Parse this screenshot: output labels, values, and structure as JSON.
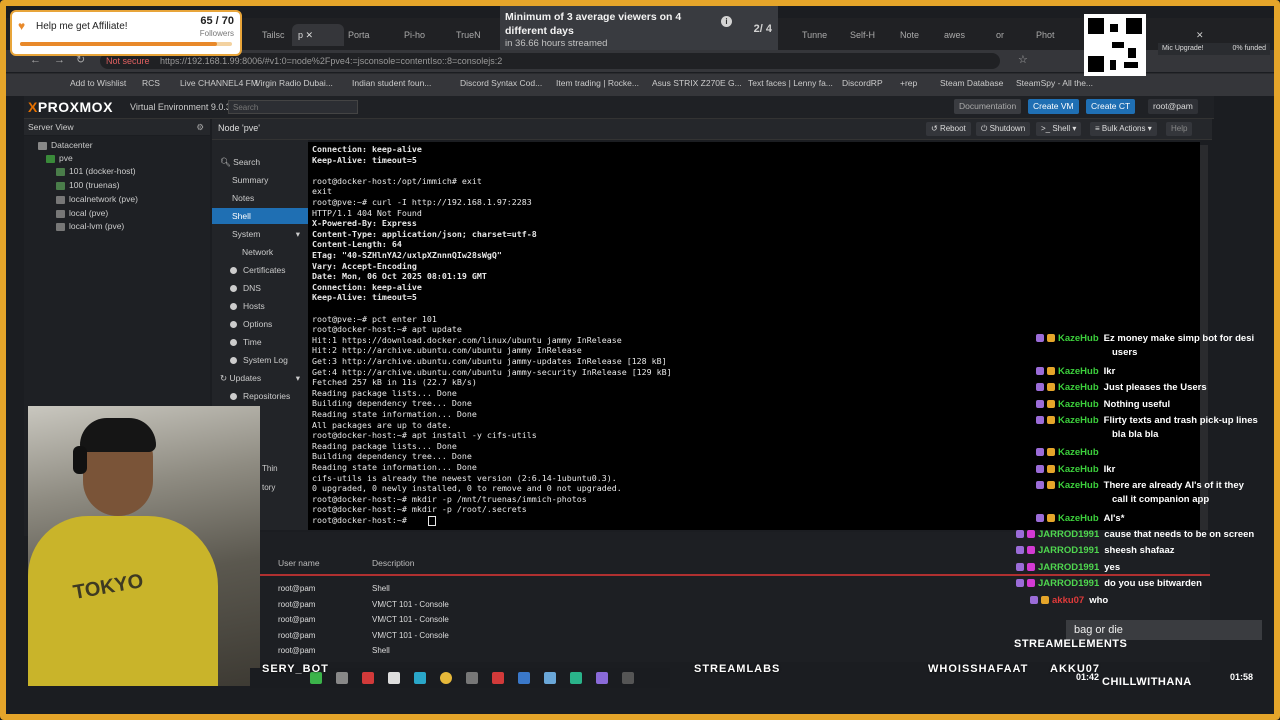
{
  "affiliate": {
    "text": "Help me get Affiliate!",
    "count": "65 / 70",
    "label": "Followers",
    "progress": 0.93
  },
  "goal": {
    "title": "Minimum of 3 average viewers on 4 different days",
    "sub": "in 36.66 hours streamed",
    "counter": "2/ 4",
    "info_icon": "i"
  },
  "mic_upgrade": {
    "label": "Mic Upgrade!",
    "funded": "0% funded",
    "progress": 0.0
  },
  "browser": {
    "tabs": [
      "Tailsc",
      "p",
      "Porta",
      "Pi-ho",
      "TrueN",
      "Tunne",
      "Self-H",
      "Note",
      "awes",
      "or",
      "Phot"
    ],
    "address_not_secure": "Not secure",
    "address": "https://192.168.1.99:8006/#v1:0=node%2Fpve4:=jsconsole=contentIso::8=consolejs:2",
    "bookmarks": [
      "Add to Wishlist",
      "RCS",
      "Live CHANNEL4 FM",
      "Virgin Radio Dubai...",
      "Indian student foun...",
      "Discord Syntax Cod...",
      "Item trading | Rocke...",
      "Asus STRIX Z270E G...",
      "Text faces | Lenny fa...",
      "DiscordRP",
      "+rep",
      "Steam Database",
      "SteamSpy - All the..."
    ]
  },
  "proxmox": {
    "logo_x": "X",
    "logo_rest": "PROXMOX",
    "version": "Virtual Environment 9.0.3",
    "search_placeholder": "Search",
    "header_buttons": {
      "docs": "Documentation",
      "create_vm": "Create VM",
      "create_ct": "Create CT",
      "user": "root@pam"
    },
    "server_view": "Server View",
    "tree": {
      "datacenter": "Datacenter",
      "node": "pve",
      "items": [
        "101 (docker-host)",
        "100 (truenas)",
        "localnetwork (pve)",
        "local (pve)",
        "local-lvm (pve)"
      ]
    },
    "node_title": "Node 'pve'",
    "node_buttons": {
      "reboot": "Reboot",
      "shutdown": "Shutdown",
      "shell": "Shell",
      "bulk": "Bulk Actions",
      "help": "Help"
    },
    "nav": [
      "Search",
      "Summary",
      "Notes",
      "Shell",
      "System",
      "Network",
      "Certificates",
      "DNS",
      "Hosts",
      "Options",
      "Time",
      "System Log",
      "Updates",
      "Repositories",
      "Thin",
      "tory"
    ],
    "task_columns": {
      "user": "User name",
      "desc": "Description"
    },
    "tasks": [
      {
        "user": "root@pam",
        "desc": "Shell"
      },
      {
        "user": "root@pam",
        "desc": "VM/CT 101 - Console"
      },
      {
        "user": "root@pam",
        "desc": "VM/CT 101 - Console"
      },
      {
        "user": "root@pam",
        "desc": "VM/CT 101 - Console"
      },
      {
        "user": "root@pam",
        "desc": "Shell"
      }
    ]
  },
  "terminal": [
    {
      "t": "Connection: keep-alive",
      "b": true
    },
    {
      "t": "Keep-Alive: timeout=5",
      "b": true
    },
    {
      "t": "",
      "b": false
    },
    {
      "t": "root@docker-host:/opt/immich# exit",
      "b": false
    },
    {
      "t": "exit",
      "b": false
    },
    {
      "t": "root@pve:~# curl -I http://192.168.1.97:2283",
      "b": false
    },
    {
      "t": "HTTP/1.1 404 Not Found",
      "b": false
    },
    {
      "t": "X-Powered-By: Express",
      "b": true
    },
    {
      "t": "Content-Type: application/json; charset=utf-8",
      "b": true
    },
    {
      "t": "Content-Length: 64",
      "b": true
    },
    {
      "t": "ETag: \"40-SZHlnYA2/uxlpXZnnnQIw28sWgQ\"",
      "b": true
    },
    {
      "t": "Vary: Accept-Encoding",
      "b": true
    },
    {
      "t": "Date: Mon, 06 Oct 2025 08:01:19 GMT",
      "b": true
    },
    {
      "t": "Connection: keep-alive",
      "b": true
    },
    {
      "t": "Keep-Alive: timeout=5",
      "b": true
    },
    {
      "t": "",
      "b": false
    },
    {
      "t": "root@pve:~# pct enter 101",
      "b": false
    },
    {
      "t": "root@docker-host:~# apt update",
      "b": false
    },
    {
      "t": "Hit:1 https://download.docker.com/linux/ubuntu jammy InRelease",
      "b": false
    },
    {
      "t": "Hit:2 http://archive.ubuntu.com/ubuntu jammy InRelease",
      "b": false
    },
    {
      "t": "Get:3 http://archive.ubuntu.com/ubuntu jammy-updates InRelease [128 kB]",
      "b": false
    },
    {
      "t": "Get:4 http://archive.ubuntu.com/ubuntu jammy-security InRelease [129 kB]",
      "b": false
    },
    {
      "t": "Fetched 257 kB in 11s (22.7 kB/s)",
      "b": false
    },
    {
      "t": "Reading package lists... Done",
      "b": false
    },
    {
      "t": "Building dependency tree... Done",
      "b": false
    },
    {
      "t": "Reading state information... Done",
      "b": false
    },
    {
      "t": "All packages are up to date.",
      "b": false
    },
    {
      "t": "root@docker-host:~# apt install -y cifs-utils",
      "b": false
    },
    {
      "t": "Reading package lists... Done",
      "b": false
    },
    {
      "t": "Building dependency tree... Done",
      "b": false
    },
    {
      "t": "Reading state information... Done",
      "b": false
    },
    {
      "t": "cifs-utils is already the newest version (2:6.14-1ubuntu0.3).",
      "b": false
    },
    {
      "t": "0 upgraded, 0 newly installed, 0 to remove and 0 not upgraded.",
      "b": false
    },
    {
      "t": "root@docker-host:~# mkdir -p /mnt/truenas/immich-photos",
      "b": false
    },
    {
      "t": "root@docker-host:~# mkdir -p /root/.secrets",
      "b": false
    },
    {
      "t": "root@docker-host:~# ",
      "b": false
    }
  ],
  "chat": [
    {
      "u": "KazeHub",
      "c": "#3ccf3c",
      "m": "Ez money make simp bot for desi",
      "m2": "users"
    },
    {
      "u": "KazeHub",
      "c": "#3ccf3c",
      "m": "Ikr"
    },
    {
      "u": "KazeHub",
      "c": "#3ccf3c",
      "m": "Just pleases the Users"
    },
    {
      "u": "KazeHub",
      "c": "#3ccf3c",
      "m": "Nothing useful"
    },
    {
      "u": "KazeHub",
      "c": "#3ccf3c",
      "m": "Flirty texts and trash pick-up lines",
      "m2": "bla bla bla"
    },
    {
      "u": "KazeHub",
      "c": "#3ccf3c",
      "m": ""
    },
    {
      "u": "KazeHub",
      "c": "#3ccf3c",
      "m": "Ikr"
    },
    {
      "u": "KazeHub",
      "c": "#3ccf3c",
      "m": "There are already AI's of it they",
      "m2": "call it companion app"
    },
    {
      "u": "KazeHub",
      "c": "#3ccf3c",
      "m": "AI's*"
    },
    {
      "u": "JARROD1991",
      "c": "#4fd64f",
      "m": "cause that needs to be on screen"
    },
    {
      "u": "JARROD1991",
      "c": "#4fd64f",
      "m": "sheesh shafaaz"
    },
    {
      "u": "JARROD1991",
      "c": "#4fd64f",
      "m": "yes"
    },
    {
      "u": "JARROD1991",
      "c": "#4fd64f",
      "m": "do you use bitwarden"
    },
    {
      "u": "akku07",
      "c": "#e03a3a",
      "m": "who"
    }
  ],
  "overlay": {
    "bag_or_die": "bag or die",
    "streamelements": "STREAMELEMENTS",
    "sery_bot": "SERY_BOT",
    "streamlabs": "STREAMLABS",
    "whoisshafaat": "WHOISSHAFAAT",
    "akku07": "AKKU07",
    "chillwithana": "CHILLWITHANA",
    "time_left": "01:42",
    "time_right": "01:58",
    "shirt_text": "TOKYO"
  },
  "colors": {
    "accent": "#1f6fb3",
    "proxmox_orange": "#e57000",
    "frame": "#e5a52a"
  }
}
